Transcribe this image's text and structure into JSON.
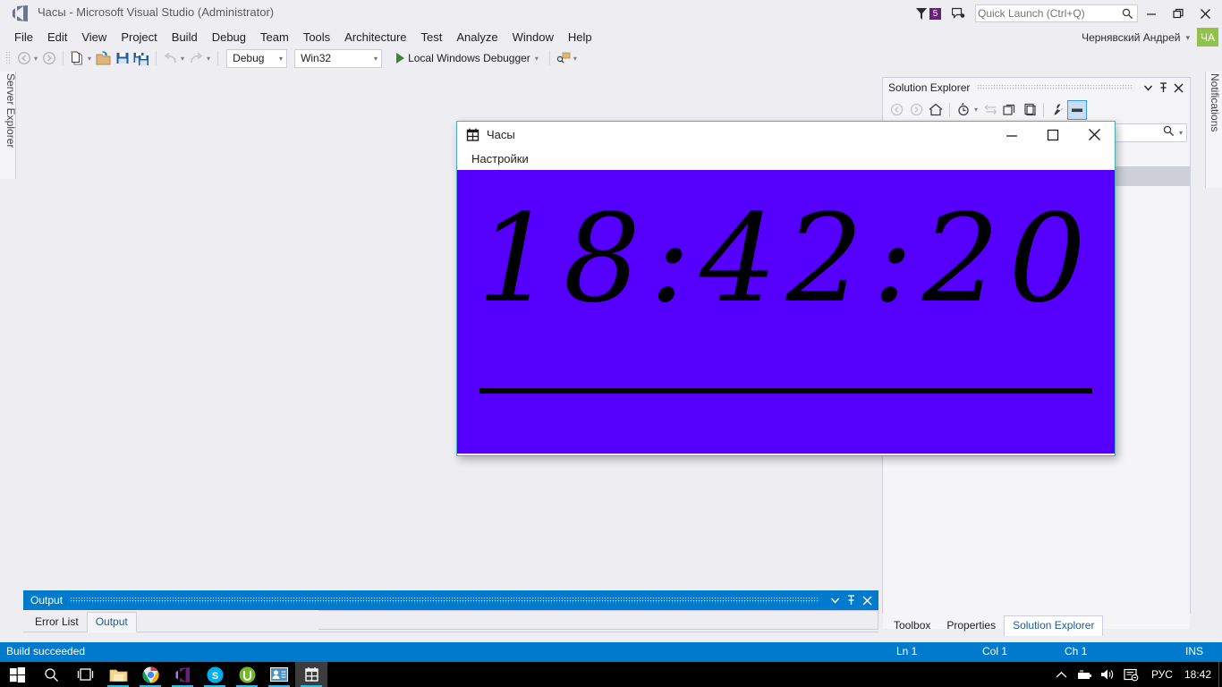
{
  "window": {
    "title": "Часы - Microsoft Visual Studio (Administrator)",
    "logo_icon": "visual-studio-logo",
    "minimize_icon": "minimize-icon",
    "restore_icon": "restore-icon",
    "close_icon": "close-icon"
  },
  "titlebar_right": {
    "notifications_icon": "flag-icon",
    "notifications_count": "5",
    "feedback_icon": "feedback-icon",
    "quick_launch_placeholder": "Quick Launch (Ctrl+Q)",
    "quick_launch_value": "",
    "search_icon": "search-icon",
    "user_name": "Чернявский Андрей",
    "user_caret": "▾",
    "user_initials": "ЧА",
    "accent_color": "#68217A",
    "avatar_color": "#91C24C"
  },
  "menubar": {
    "items": [
      {
        "label": "File"
      },
      {
        "label": "Edit"
      },
      {
        "label": "View"
      },
      {
        "label": "Project"
      },
      {
        "label": "Build"
      },
      {
        "label": "Debug"
      },
      {
        "label": "Team"
      },
      {
        "label": "Tools"
      },
      {
        "label": "Architecture"
      },
      {
        "label": "Test"
      },
      {
        "label": "Analyze"
      },
      {
        "label": "Window"
      },
      {
        "label": "Help"
      }
    ]
  },
  "toolbar": {
    "navigate_back_icon": "navigate-back-icon",
    "navigate_back_caret": "▾",
    "navigate_forward_icon": "navigate-forward-icon",
    "new_item_icon": "new-item-icon",
    "new_item_caret": "▾",
    "open_file_icon": "open-file-icon",
    "save_icon": "save-icon",
    "save_all_icon": "save-all-icon",
    "undo_icon": "undo-icon",
    "undo_caret": "▾",
    "redo_icon": "redo-icon",
    "redo_caret": "▾",
    "config_value": "Debug",
    "config_caret": "▾",
    "platform_value": "Win32",
    "platform_caret": "▾",
    "run_icon": "play-icon",
    "run_label": "Local Windows Debugger",
    "run_caret": "▾",
    "attach_icon": "attach-process-icon",
    "overflow_caret": "▾"
  },
  "left_rail": {
    "tab_label": "Server Explorer"
  },
  "right_rail": {
    "tab_label": "Notifications"
  },
  "solution_explorer": {
    "title": "Solution Explorer",
    "dropdown_icon": "chevron-down-icon",
    "pin_icon": "pin-icon",
    "close_icon": "close-icon",
    "tools": [
      {
        "name": "back-icon",
        "label": "◀"
      },
      {
        "name": "forward-icon",
        "label": "▶"
      },
      {
        "name": "home-icon",
        "label": "⌂"
      },
      {
        "name": "pending-changes-icon",
        "label": "◔"
      },
      {
        "name": "sync-icon",
        "label": "⇄"
      },
      {
        "name": "collapse-all-icon",
        "label": "▤"
      },
      {
        "name": "show-all-files-icon",
        "label": "▥"
      },
      {
        "name": "properties-icon",
        "label": "🔧"
      },
      {
        "name": "preview-selected-items-icon",
        "label": "▬"
      }
    ],
    "search_icon": "search-icon",
    "search_caret": "▾",
    "search_value": ""
  },
  "output_panel": {
    "title": "Output",
    "dropdown_icon": "chevron-down-icon",
    "pin_icon": "pin-icon",
    "close_icon": "close-icon",
    "tabs": [
      {
        "label": "Error List",
        "active": false
      },
      {
        "label": "Output",
        "active": true
      }
    ]
  },
  "dock_tabs": {
    "tabs": [
      {
        "label": "Toolbox",
        "active": false
      },
      {
        "label": "Properties",
        "active": false
      },
      {
        "label": "Solution Explorer",
        "active": true
      }
    ]
  },
  "statusbar": {
    "message": "Build succeeded",
    "line": "Ln 1",
    "column": "Col 1",
    "character": "Ch 1",
    "insert_mode": "INS",
    "background": "#007ACC"
  },
  "clock_app": {
    "icon": "calendar-grid-icon",
    "title": "Часы",
    "minimize_icon": "minimize-icon",
    "maximize_icon": "maximize-icon",
    "close_icon": "close-icon",
    "menu": [
      {
        "label": "Настройки"
      }
    ],
    "time": "18:42:20",
    "background_color": "#5500FF",
    "foreground_color": "#000000",
    "border_color": "#4AAFBF"
  },
  "taskbar": {
    "items": [
      {
        "name": "start-button",
        "icon": "windows-logo-icon"
      },
      {
        "name": "search-button",
        "icon": "search-icon"
      },
      {
        "name": "task-view-button",
        "icon": "task-view-icon"
      },
      {
        "name": "file-explorer-button",
        "icon": "folder-icon"
      },
      {
        "name": "chrome-button",
        "icon": "chrome-icon"
      },
      {
        "name": "visual-studio-button",
        "icon": "visual-studio-icon"
      },
      {
        "name": "skype-button",
        "icon": "skype-icon"
      },
      {
        "name": "utorrent-button",
        "icon": "utorrent-icon"
      },
      {
        "name": "contacts-button",
        "icon": "contacts-icon"
      },
      {
        "name": "clock-app-button",
        "icon": "calendar-grid-icon"
      }
    ],
    "tray": {
      "expand_icon": "chevron-up-icon",
      "battery_icon": "battery-icon",
      "volume_icon": "volume-icon",
      "action-center_icon": "action-center-icon",
      "language": "РУС",
      "clock": "18:42"
    }
  }
}
